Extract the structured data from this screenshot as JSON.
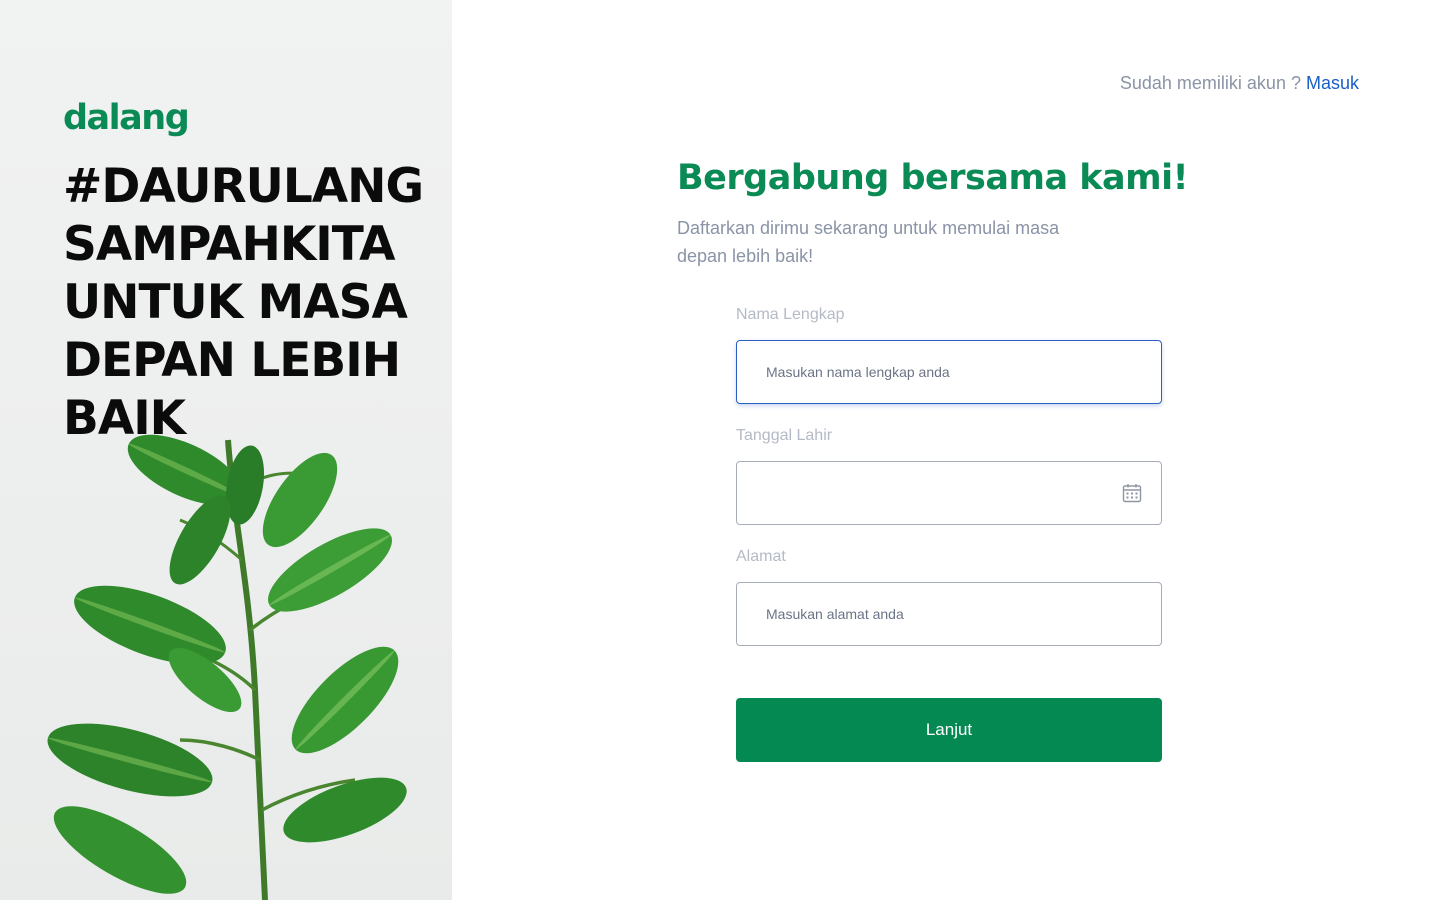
{
  "brand": {
    "logo": "dalang",
    "tagline": "#DAURULANG SAMPAHKITA UNTUK MASA DEPAN LEBIH BAIK"
  },
  "header": {
    "login_prompt": "Sudah memiliki akun ?",
    "login_link": "Masuk"
  },
  "form": {
    "title": "Bergabung bersama kami!",
    "subtitle": "Daftarkan dirimu sekarang untuk memulai masa depan lebih baik!",
    "fields": [
      {
        "label": "Nama Lengkap",
        "placeholder": "Masukan nama lengkap anda",
        "value": ""
      },
      {
        "label": "Tanggal Lahir",
        "placeholder": "",
        "value": ""
      },
      {
        "label": "Alamat",
        "placeholder": "Masukan alamat anda",
        "value": ""
      }
    ],
    "submit_label": "Lanjut"
  },
  "colors": {
    "brand_green": "#0a8a55",
    "button_green": "#058952",
    "link_blue": "#1a5fc7",
    "muted_text": "#8a94a6"
  },
  "icons": {
    "date_field": "calendar-icon"
  }
}
